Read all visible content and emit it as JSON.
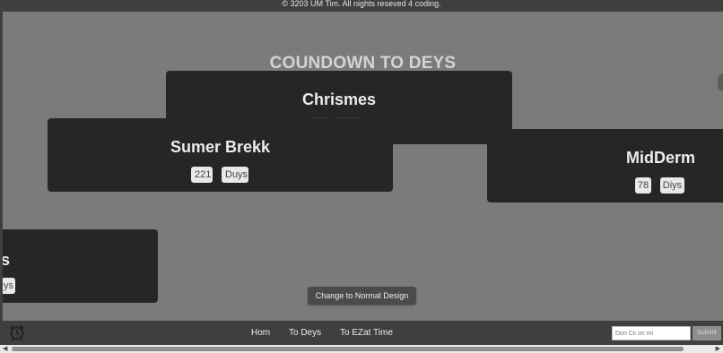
{
  "footer_top": {
    "copyright": "© 3203 UM Tim. All nights reseved 4 coding."
  },
  "page": {
    "title": "COUNDOWN TO DEYS"
  },
  "cards": {
    "christmas": {
      "title": "Chrismes"
    },
    "summer": {
      "title": "Sumer Brekk",
      "days": "221",
      "unit": "Duys"
    },
    "midterm": {
      "title": "MidDerm",
      "days": "78",
      "unit": "Diys"
    },
    "offscreen": {
      "title_fragment": "s",
      "unit_fragment": "ys"
    }
  },
  "design_toggle": {
    "label": "Change to Normal Design"
  },
  "navbar": {
    "logo_icon": "alarm-clock-icon",
    "links": [
      {
        "label": "Hom"
      },
      {
        "label": "To Deys"
      },
      {
        "label": "To EZat Time"
      }
    ],
    "subscribe": {
      "placeholder": "Don Cli on mi",
      "submit_label": "Submit"
    }
  },
  "scrollbar": {
    "left_arrow": "◀",
    "right_arrow": "▶"
  },
  "colors": {
    "page_background": "#7b7b7b",
    "bar_background": "#3f3f3f",
    "card_background": "#282525",
    "title_text": "#d4d4d4",
    "pill_background": "#e9e9e9"
  }
}
